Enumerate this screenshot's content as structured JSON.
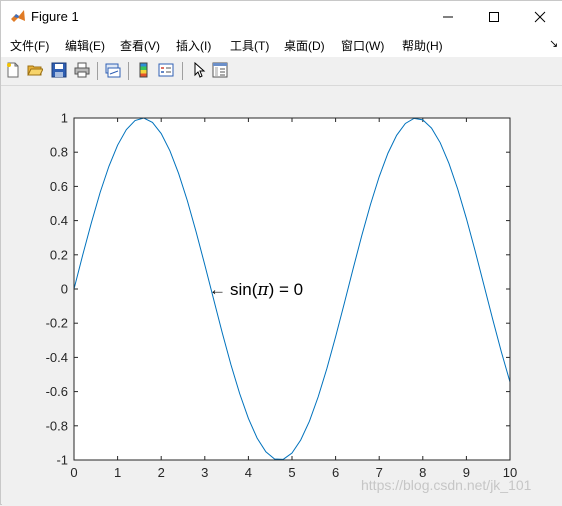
{
  "window": {
    "title": "Figure 1",
    "buttons": {
      "minimize": "minimize",
      "maximize": "maximize",
      "close": "close"
    }
  },
  "menu": {
    "items": [
      {
        "label": "文件(F)"
      },
      {
        "label": "编辑(E)"
      },
      {
        "label": "查看(V)"
      },
      {
        "label": "插入(I)"
      },
      {
        "label": "工具(T)"
      },
      {
        "label": "桌面(D)"
      },
      {
        "label": "窗口(W)"
      },
      {
        "label": "帮助(H)"
      }
    ],
    "overflow_glyph": "↘"
  },
  "toolbar": {
    "icons": [
      "new-figure-icon",
      "open-file-icon",
      "save-icon",
      "print-icon",
      "link-plot-icon",
      "colorbar-icon",
      "legend-icon",
      "pointer-icon",
      "property-inspector-icon"
    ]
  },
  "colors": {
    "line": "#0072bd",
    "axes_bg": "#ffffff",
    "figure_bg": "#f0f0f0"
  },
  "chart_data": {
    "type": "line",
    "title": "",
    "xlabel": "",
    "ylabel": "",
    "xlim": [
      0,
      10
    ],
    "ylim": [
      -1,
      1
    ],
    "xticks": [
      0,
      1,
      2,
      3,
      4,
      5,
      6,
      7,
      8,
      9,
      10
    ],
    "xtick_labels": [
      "0",
      "1",
      "2",
      "3",
      "4",
      "5",
      "6",
      "7",
      "8",
      "9",
      "10"
    ],
    "yticks": [
      -1,
      -0.8,
      -0.6,
      -0.4,
      -0.2,
      0,
      0.2,
      0.4,
      0.6,
      0.8,
      1
    ],
    "ytick_labels": [
      "-1",
      "-0.8",
      "-0.6",
      "-0.4",
      "-0.2",
      "0",
      "0.2",
      "0.4",
      "0.6",
      "0.8",
      "1"
    ],
    "grid": false,
    "series": [
      {
        "function": "sin(x)",
        "x": [
          0,
          0.2,
          0.4,
          0.6,
          0.8,
          1.0,
          1.2,
          1.4,
          1.6,
          1.8,
          2.0,
          2.2,
          2.4,
          2.6,
          2.8,
          3.0,
          3.2,
          3.4,
          3.6,
          3.8,
          4.0,
          4.2,
          4.4,
          4.6,
          4.8,
          5.0,
          5.2,
          5.4,
          5.6,
          5.8,
          6.0,
          6.2,
          6.4,
          6.6,
          6.8,
          7.0,
          7.2,
          7.4,
          7.6,
          7.8,
          8.0,
          8.2,
          8.4,
          8.6,
          8.8,
          9.0,
          9.2,
          9.4,
          9.6,
          9.8,
          10.0
        ],
        "y": [
          0,
          0.199,
          0.389,
          0.565,
          0.717,
          0.841,
          0.932,
          0.985,
          1.0,
          0.974,
          0.909,
          0.808,
          0.675,
          0.516,
          0.335,
          0.141,
          -0.058,
          -0.256,
          -0.443,
          -0.612,
          -0.757,
          -0.872,
          -0.952,
          -0.994,
          -0.996,
          -0.959,
          -0.883,
          -0.773,
          -0.631,
          -0.465,
          -0.279,
          -0.083,
          0.117,
          0.312,
          0.494,
          0.657,
          0.794,
          0.899,
          0.968,
          0.998,
          0.989,
          0.941,
          0.855,
          0.734,
          0.585,
          0.412,
          0.223,
          0.025,
          -0.174,
          -0.366,
          -0.544
        ]
      }
    ],
    "annotations": [
      {
        "text": "\\leftarrow sin(\\pi) = 0",
        "arrow": "←",
        "label": "sin(",
        "pi": "π",
        "label_end": ") = 0",
        "x": 3.1416,
        "y": 0
      }
    ]
  },
  "watermark": "https://blog.csdn.net/jk_101"
}
